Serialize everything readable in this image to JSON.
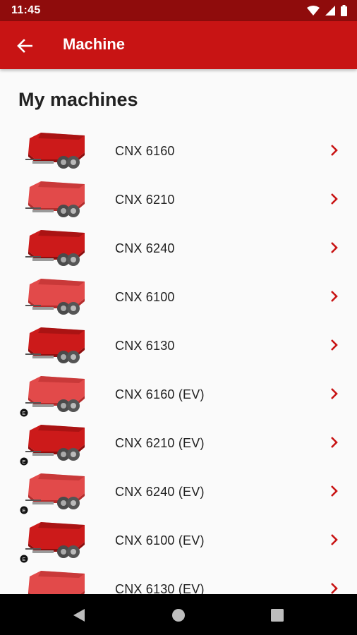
{
  "status": {
    "time": "11:45"
  },
  "app_bar": {
    "title": "Machine"
  },
  "section": {
    "title": "My machines"
  },
  "machines": [
    {
      "label": "CNX 6160",
      "ev": false
    },
    {
      "label": "CNX 6210",
      "ev": false
    },
    {
      "label": "CNX 6240",
      "ev": false
    },
    {
      "label": "CNX 6100",
      "ev": false
    },
    {
      "label": "CNX 6130",
      "ev": false
    },
    {
      "label": "CNX 6160 (EV)",
      "ev": true
    },
    {
      "label": "CNX 6210 (EV)",
      "ev": true
    },
    {
      "label": "CNX 6240 (EV)",
      "ev": true
    },
    {
      "label": "CNX 6100 (EV)",
      "ev": true
    },
    {
      "label": "CNX 6130 (EV)",
      "ev": true
    }
  ],
  "colors": {
    "app_bar": "#c81414",
    "status_bar": "#8f0c0c",
    "accent": "#c81414"
  },
  "icons": {
    "back": "arrow-left-icon",
    "chevron": "chevron-right-icon",
    "wifi": "wifi-icon",
    "signal": "signal-icon",
    "battery": "battery-icon"
  }
}
